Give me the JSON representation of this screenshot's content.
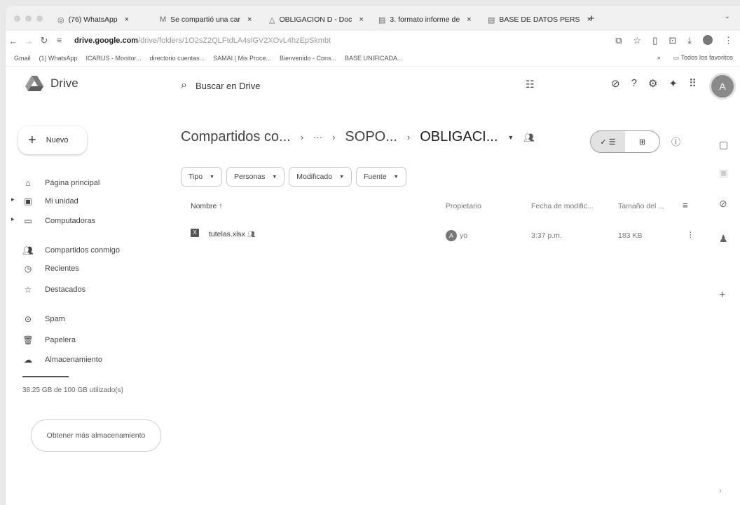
{
  "browser": {
    "tabs": [
      {
        "icon": "WA",
        "label": "(76) WhatsApp",
        "close": "×"
      },
      {
        "icon": "M",
        "label": "Se compartió una car",
        "close": "×"
      },
      {
        "icon": "△",
        "label": "OBLIGACION D - Doc",
        "close": "×"
      },
      {
        "icon": "▤",
        "label": "3. formato informe de",
        "close": "×"
      },
      {
        "icon": "▤",
        "label": "BASE DE DATOS PERS",
        "close": "×"
      }
    ],
    "new_tab": "+",
    "url_host": "drive.google.com",
    "url_path": "/drive/folders/1O2sZ2QLFtdLA4slGV2XOvL4hzEpSkmbt",
    "bookmarks": [
      "Gmail",
      "(1) WhatsApp",
      "ICARUS - Monitor...",
      "directorio cuentas...",
      "SAMAI | Mis Proce...",
      "Bienvenido - Cons...",
      "BASE UNIFICADA..."
    ],
    "bookmarks_more": "»",
    "all_bookmarks": "Todos los favoritos"
  },
  "drive": {
    "logo_text": "Drive",
    "search_placeholder": "Buscar en Drive",
    "avatar_letter": "A",
    "new_label": "Nuevo",
    "nav": [
      {
        "label": "Página principal",
        "icon": "home-icon"
      },
      {
        "label": "Mi unidad",
        "icon": "my-drive-icon"
      },
      {
        "label": "Computadoras",
        "icon": "computer-icon"
      },
      {
        "label": "Compartidos conmigo",
        "icon": "shared-icon"
      },
      {
        "label": "Recientes",
        "icon": "clock-icon"
      },
      {
        "label": "Destacados",
        "icon": "star-icon"
      },
      {
        "label": "Spam",
        "icon": "spam-icon"
      },
      {
        "label": "Papelera",
        "icon": "trash-icon"
      },
      {
        "label": "Almacenamiento",
        "icon": "cloud-icon"
      }
    ],
    "storage_text": "38.25 GB de 100 GB utilizado(s)",
    "storage_fraction": 0.3825,
    "get_more": "Obtener más almacenamiento",
    "breadcrumb": {
      "root": "Compartidos co...",
      "ellipsis": "···",
      "parent": "SOPO...",
      "current": "OBLIGACI..."
    },
    "filters": [
      "Tipo",
      "Personas",
      "Modificado",
      "Fuente"
    ],
    "columns": {
      "name": "Nombre",
      "owner": "Propietario",
      "modified": "Fecha de modific...",
      "size": "Tamaño del ..."
    },
    "files": [
      {
        "name": "tutelas.xlsx",
        "owner": "yo",
        "owner_initial": "A",
        "modified": "3:37 p.m.",
        "size": "183 KB"
      }
    ]
  }
}
